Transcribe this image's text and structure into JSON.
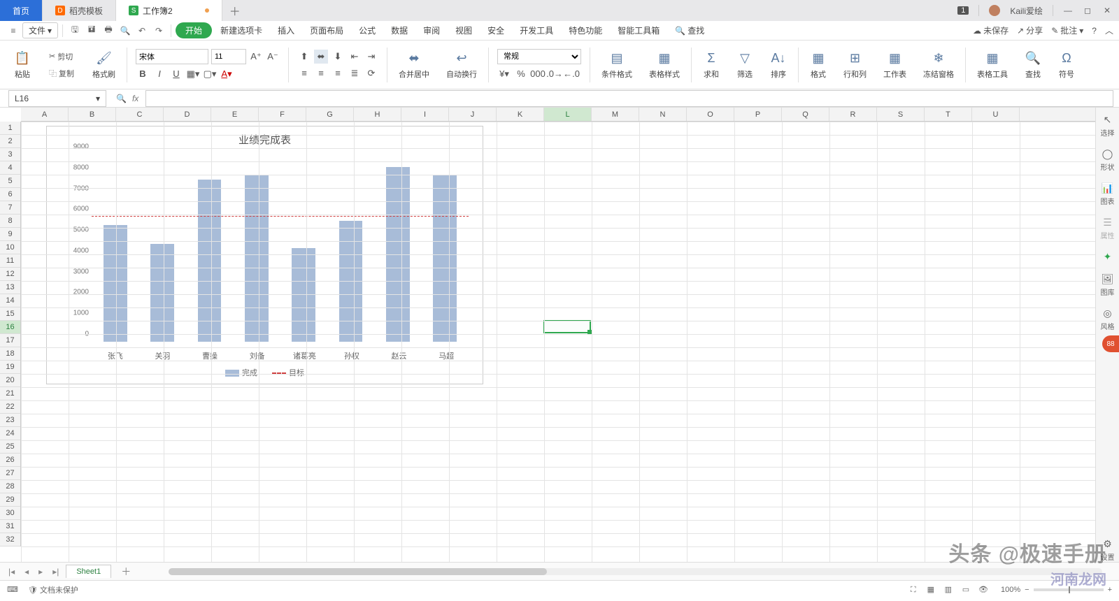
{
  "titlebar": {
    "home": "首页",
    "tab1": "稻壳模板",
    "tab2": "工作簿2",
    "badge": "1",
    "user": "Kaili爱绘"
  },
  "menubar": {
    "file": "文件",
    "start": "开始",
    "newtab": "新建选项卡",
    "insert": "插入",
    "pagelayout": "页面布局",
    "formula": "公式",
    "data": "数据",
    "review": "审阅",
    "view": "视图",
    "security": "安全",
    "devtools": "开发工具",
    "special": "特色功能",
    "smartbox": "智能工具箱",
    "search": "查找",
    "unsaved": "未保存",
    "share": "分享",
    "comment": "批注"
  },
  "ribbon": {
    "paste": "粘贴",
    "cut": "剪切",
    "copy": "复制",
    "formatpainter": "格式刷",
    "fontname": "宋体",
    "fontsize": "11",
    "mergecenter": "合并居中",
    "autowrap": "自动换行",
    "numberformat": "常规",
    "condformat": "条件格式",
    "tablestyle": "表格样式",
    "sum": "求和",
    "filter": "筛选",
    "sort": "排序",
    "format": "格式",
    "rowcol": "行和列",
    "worksheet": "工作表",
    "freeze": "冻结窗格",
    "tabletool": "表格工具",
    "find": "查找",
    "symbol": "符号"
  },
  "formula": {
    "cellref": "L16"
  },
  "side": {
    "select": "选择",
    "shape": "形状",
    "chart": "图表",
    "prop": "属性",
    "gallery": "图库",
    "style": "风格",
    "settings": "设置"
  },
  "sheets": {
    "sheet1": "Sheet1"
  },
  "status": {
    "docprotect": "文档未保护",
    "zoom": "100%"
  },
  "watermarks": {
    "top": "头条 @极速手册",
    "bottom": "河南龙网"
  },
  "chart_data": {
    "type": "bar",
    "title": "业绩完成表",
    "categories": [
      "张飞",
      "关羽",
      "曹操",
      "刘备",
      "诸葛亮",
      "孙权",
      "赵云",
      "马超"
    ],
    "series": [
      {
        "name": "完成",
        "values": [
          5600,
          4700,
          7800,
          8000,
          4500,
          5800,
          8400,
          8000
        ]
      },
      {
        "name": "目标",
        "values": [
          6000,
          6000,
          6000,
          6000,
          6000,
          6000,
          6000,
          6000
        ]
      }
    ],
    "ylim": [
      0,
      9000
    ],
    "yticks": [
      0,
      1000,
      2000,
      3000,
      4000,
      5000,
      6000,
      7000,
      8000,
      9000
    ],
    "legend": [
      "完成",
      "目标"
    ]
  },
  "grid": {
    "cols": [
      "A",
      "B",
      "C",
      "D",
      "E",
      "F",
      "G",
      "H",
      "I",
      "J",
      "K",
      "L",
      "M",
      "N",
      "O",
      "P",
      "Q",
      "R",
      "S",
      "T",
      "U"
    ],
    "rows": 32,
    "selected": {
      "col": "L",
      "row": 16
    }
  }
}
